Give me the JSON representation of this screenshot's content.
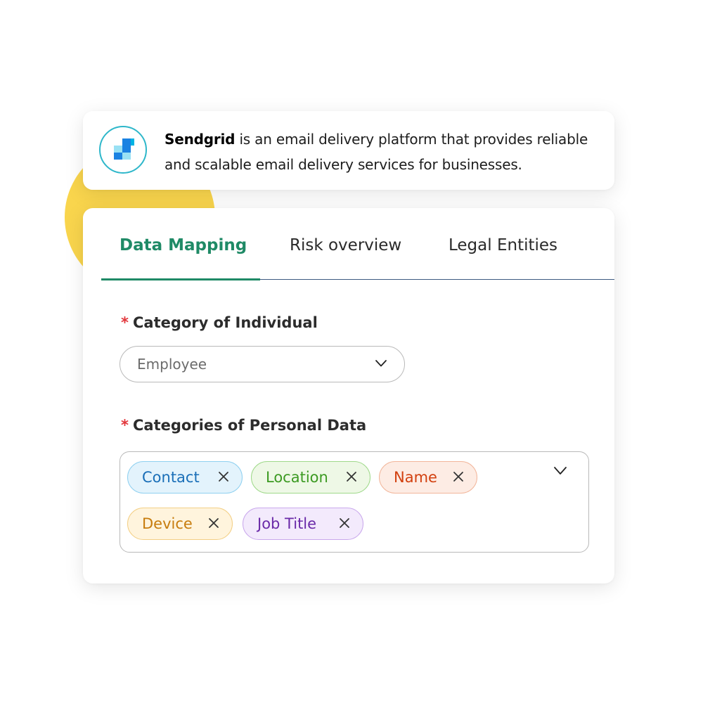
{
  "info_card": {
    "brand": "Sendgrid",
    "description_line1": " is an email delivery platform that provides reliable",
    "description_line2": "and scalable email delivery services for businesses."
  },
  "tabs": [
    {
      "label": "Data Mapping",
      "active": true
    },
    {
      "label": "Risk overview",
      "active": false
    },
    {
      "label": "Legal Entities",
      "active": false
    }
  ],
  "category_individual": {
    "required_marker": "*",
    "label": "Category of Individual",
    "value": "Employee"
  },
  "categories_personal_data": {
    "required_marker": "*",
    "label": "Categories of Personal Data",
    "chips": [
      {
        "label": "Contact",
        "color": "#1a6fb8",
        "bg": "#e3f3fc",
        "border": "#8fd0f0"
      },
      {
        "label": "Location",
        "color": "#3c9a22",
        "bg": "#eef8e6",
        "border": "#9fd98a"
      },
      {
        "label": "Name",
        "color": "#d2400f",
        "bg": "#fdece4",
        "border": "#f2b69b"
      },
      {
        "label": "Device",
        "color": "#c77c0d",
        "bg": "#fff4dd",
        "border": "#f3cf85"
      },
      {
        "label": "Job Title",
        "color": "#6a2aa8",
        "bg": "#f3eafc",
        "border": "#c9a8ec"
      }
    ]
  },
  "colors": {
    "accent_green": "#1f8a66",
    "required_red": "#e2363b",
    "yellow_blob": "#f9d54d",
    "tab_rule": "#3d5a80"
  },
  "icons": {
    "logo": "sendgrid-logo-icon",
    "dropdown": "chevron-down-icon",
    "remove": "close-icon"
  }
}
